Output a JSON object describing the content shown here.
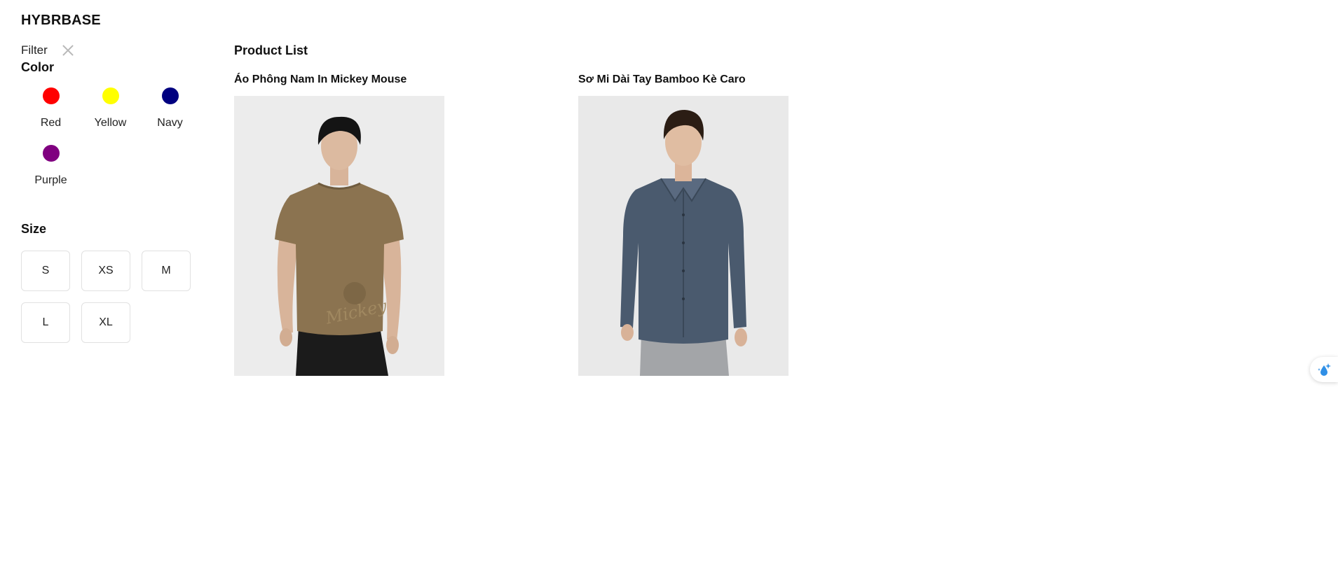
{
  "brand": "HYBRBASE",
  "filter": {
    "label": "Filter",
    "color_title": "Color",
    "colors": [
      {
        "label": "Red",
        "hex": "#ff0000"
      },
      {
        "label": "Yellow",
        "hex": "#ffff00"
      },
      {
        "label": "Navy",
        "hex": "#000080"
      },
      {
        "label": "Purple",
        "hex": "#800080"
      }
    ],
    "size_title": "Size",
    "sizes": [
      "S",
      "XS",
      "M",
      "L",
      "XL"
    ]
  },
  "product_list": {
    "title": "Product List",
    "products": [
      {
        "name": "Áo Phông Nam In Mickey Mouse"
      },
      {
        "name": "Sơ Mi Dài Tay Bamboo Kè Caro"
      }
    ]
  },
  "icons": {
    "close": "close-icon",
    "floating_tool": "water-drop-sparkle-icon"
  }
}
